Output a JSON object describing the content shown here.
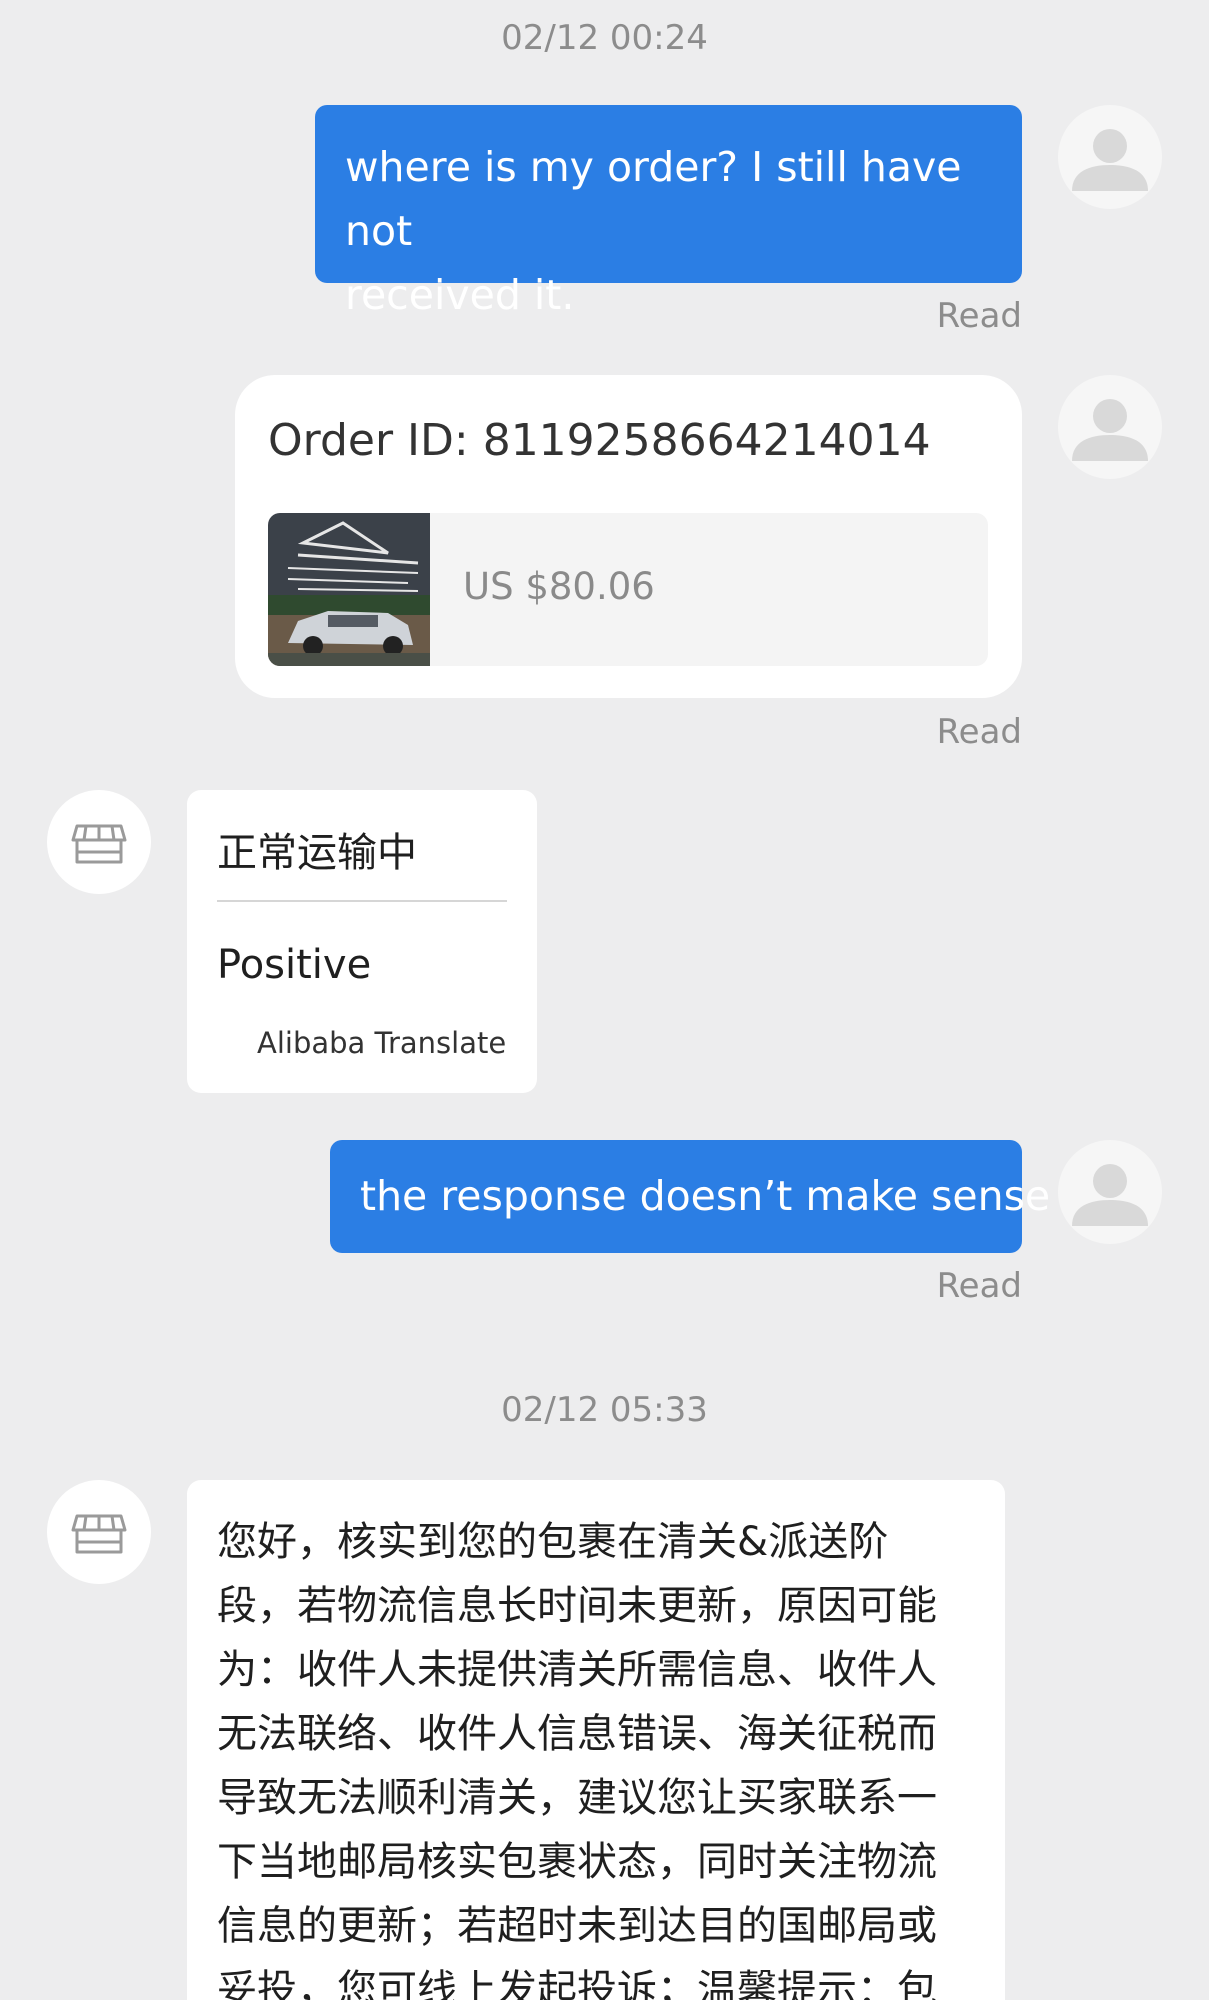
{
  "timestamps": [
    "02/12 00:24",
    "02/12 05:33"
  ],
  "messages": {
    "m1": {
      "text_line1": "where is my order? I still have not",
      "text_line2": "received it.",
      "status": "Read"
    },
    "m2": {
      "order_id": "Order ID: 8119258664214014",
      "price": "US $80.06",
      "status": "Read"
    },
    "m3": {
      "original": "正常运输中",
      "translation": "Positive",
      "translated_by": "Alibaba Translate"
    },
    "m4": {
      "text": "the response doesn’t make sense",
      "status": "Read"
    },
    "m5": {
      "lines": [
        "您好，核实到您的包裹在清关&派送阶",
        "段，若物流信息长时间未更新，原因可能",
        "为：收件人未提供清关所需信息、收件人",
        "无法联络、收件人信息错误、海关征税而",
        "导致无法顺利清关，建议您让买家联系一",
        "下当地邮局核实包裹状态，同时关注物流",
        "信息的更新；若超时未到达目的国邮局或",
        "妥投，您可线上发起投诉；温馨提示：包"
      ]
    }
  },
  "icons": {
    "user_avatar": "user-avatar-icon",
    "store_avatar": "store-icon",
    "product_thumbnail": "product-thumbnail"
  },
  "colors": {
    "background": "#ededee",
    "outgoing_bubble": "#2b7ee4",
    "incoming_bubble": "#ffffff",
    "muted_text": "#8c8c8c"
  }
}
